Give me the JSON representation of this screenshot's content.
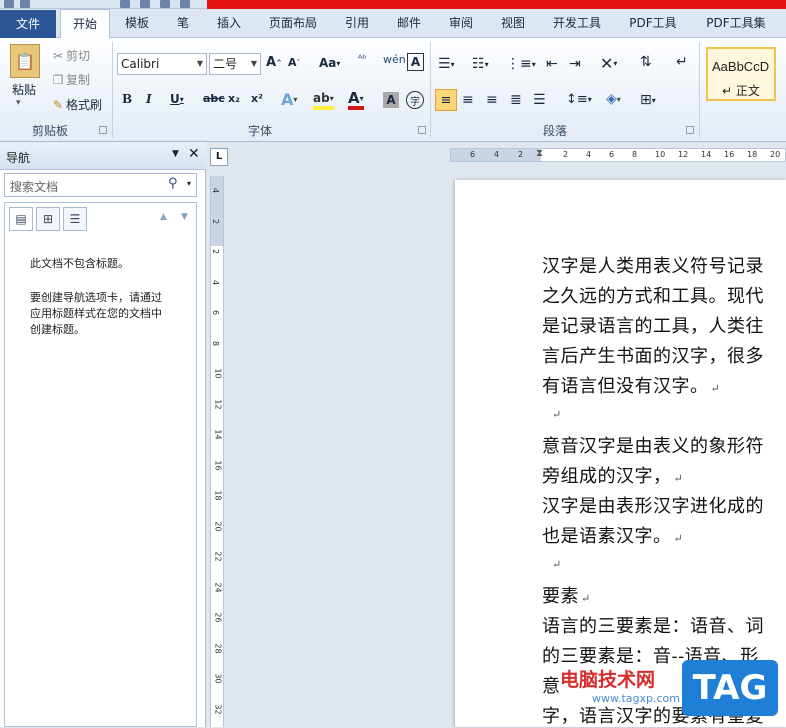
{
  "tabs": [
    "文件",
    "开始",
    "模板",
    "笔",
    "插入",
    "页面布局",
    "引用",
    "邮件",
    "审阅",
    "视图",
    "开发工具",
    "PDF工具",
    "PDF工具集"
  ],
  "ribbon": {
    "clipboard": {
      "paste": "粘贴",
      "cut": "剪切",
      "copy": "复制",
      "format_painter": "格式刷",
      "label": "剪贴板"
    },
    "font": {
      "name": "Calibri",
      "size": "二号",
      "label": "字体"
    },
    "paragraph": {
      "label": "段落"
    },
    "styles": {
      "sample": "AaBbCcD",
      "name": "↵ 正文"
    }
  },
  "nav": {
    "title": "导航",
    "search_placeholder": "搜索文档",
    "empty_msg": "此文档不包含标题。",
    "hint": "要创建导航选项卡，请通过应用标题样式在您的文档中创建标题。",
    "hint_lines": [
      "要创建导航选项卡，请通过",
      "应用标题样式在您的文档中",
      "创建标题。"
    ]
  },
  "document": {
    "lines": [
      "汉字是人类用表义符号记录",
      "之久远的方式和工具。现代",
      "是记录语言的工具，人类往",
      "言后产生书面的汉字，很多",
      "有语言但没有汉字。",
      "",
      "意音汉字是由表义的象形符",
      "旁组成的汉字，",
      "汉字是由表形汉字进化成的",
      "也是语素汉字。",
      "",
      "要素",
      "语言的三要素是：语音、词",
      "的三要素是：音--语音、形",
      "意",
      "字，语言汉字的要素有望复"
    ]
  },
  "rulers": {
    "h_ticks": [
      "6",
      "4",
      "2",
      "2",
      "4",
      "6",
      "8",
      "10",
      "12",
      "14",
      "16",
      "18",
      "20"
    ],
    "v_ticks": [
      "4",
      "2",
      "2",
      "4",
      "6",
      "8",
      "10",
      "12",
      "14",
      "16",
      "18",
      "20",
      "22",
      "24",
      "26",
      "28",
      "30",
      "32"
    ]
  },
  "watermark": {
    "site": "电脑技术网",
    "url": "www.tagxp.com",
    "logo": "TAG"
  },
  "colors": {
    "accent": "#2b5797",
    "red_bar": "#e31212",
    "ribbon": "#e3ebf5"
  }
}
